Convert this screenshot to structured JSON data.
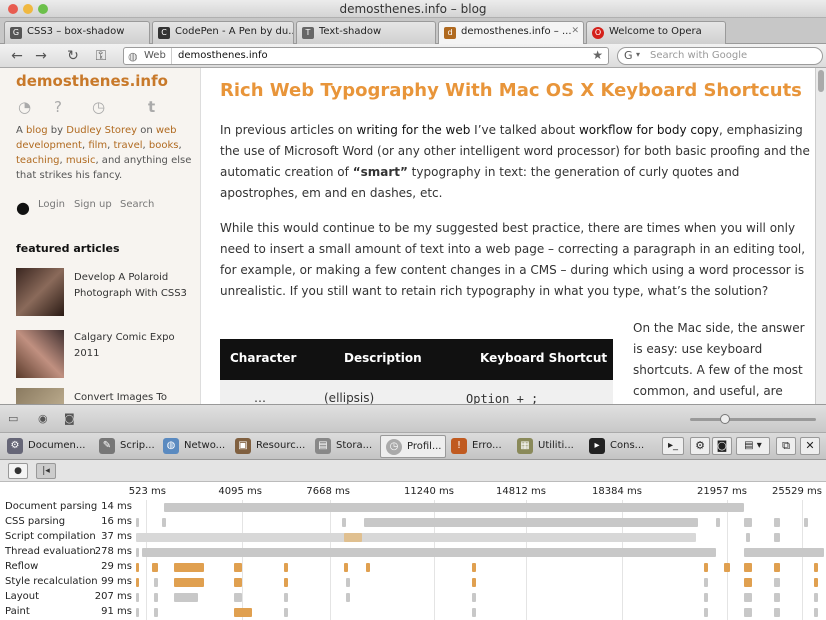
{
  "window": {
    "title": "demosthenes.info – blog"
  },
  "tabs": [
    {
      "label": "CSS3 – box-shadow",
      "favicon": "G"
    },
    {
      "label": "CodePen - A Pen by du...",
      "favicon": "C"
    },
    {
      "label": "Text-shadow",
      "favicon": "T"
    },
    {
      "label": "demosthenes.info – ...",
      "favicon": "d",
      "active": true
    },
    {
      "label": "Welcome to Opera",
      "favicon": "O"
    }
  ],
  "nav": {
    "web_label": "Web",
    "url": "demosthenes.info",
    "search_placeholder": "Search with Google"
  },
  "sidebar": {
    "site_title": "demosthenes.info",
    "intro": {
      "p1": "A ",
      "l1": "blog",
      "p2": " by ",
      "l2": "Dudley Storey",
      "p3": " on ",
      "l3": "web development",
      "p4": ", ",
      "l4": "film",
      "p5": ", ",
      "l5": "travel",
      "p6": ", ",
      "l6": "books",
      "p7": ", ",
      "l7": "teaching",
      "p8": ", ",
      "l8": "music",
      "p9": ", and anything else that strikes his fancy."
    },
    "login": "Login",
    "signup": "Sign up",
    "search": "Search",
    "featured_heading": "featured articles",
    "articles": [
      "Develop A Polaroid Photograph With CSS3",
      "Calgary Comic Expo 2011",
      "Convert Images To"
    ]
  },
  "article": {
    "title": "Rich Web Typography With Mac OS X Keyboard Shortcuts",
    "para1": {
      "a": "In previous articles on ",
      "l1": "writing for the web",
      "b": " I’ve talked about ",
      "l2": "workflow for body copy",
      "c": ", emphasizing the use of Microsoft Word (or any other intelligent word processor) for both basic proofing and the automatic creation of ",
      "q": "“smart”",
      "d": " typography in text: the generation of curly quotes and apostrophes, em and en dashes, etc."
    },
    "para2": "While this would continue to be my suggested best practice, there are times when you will only need to insert a small amount of text into a web page – correcting a paragraph in an editing tool, for example, or making a few content changes in a CMS – during which using a word processor is unrealistic. If you still want to retain rich typography in what you type, what’s the solution?",
    "table": {
      "headers": [
        "Character",
        "Description",
        "Keyboard Shortcut"
      ],
      "row1": [
        "…",
        "(ellipsis)",
        "Option + ;"
      ]
    },
    "para3": "On the Mac side, the answer is easy: use keyboard shortcuts. A few of the most common, and useful, are shown in the"
  },
  "devtools": {
    "tabs": [
      "Documen...",
      "Scrip...",
      "Netwo...",
      "Resourc...",
      "Stora...",
      "Profil...",
      "Erro...",
      "Utiliti...",
      "Cons..."
    ],
    "active_tab": "Profil...",
    "ticks": [
      "523 ms",
      "4095 ms",
      "7668 ms",
      "11240 ms",
      "14812 ms",
      "18384 ms",
      "21957 ms",
      "25529 ms"
    ],
    "rows": [
      {
        "label": "Document parsing",
        "value": "14 ms"
      },
      {
        "label": "CSS parsing",
        "value": "16 ms"
      },
      {
        "label": "Script compilation",
        "value": "37 ms"
      },
      {
        "label": "Thread evaluation",
        "value": "278 ms"
      },
      {
        "label": "Reflow",
        "value": "29 ms"
      },
      {
        "label": "Style recalculation",
        "value": "99 ms"
      },
      {
        "label": "Layout",
        "value": "207 ms"
      },
      {
        "label": "Paint",
        "value": "91 ms"
      }
    ]
  }
}
